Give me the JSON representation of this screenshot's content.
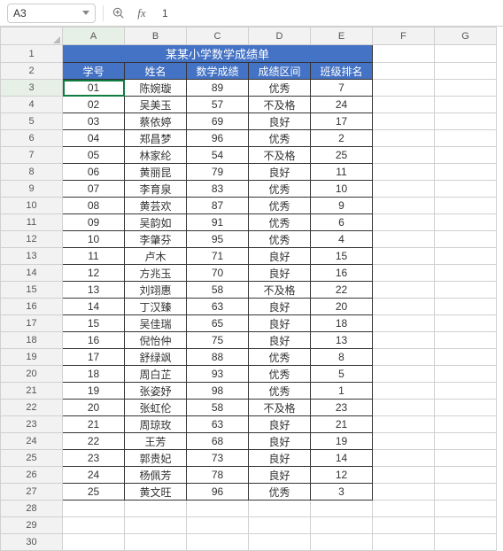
{
  "toolbar": {
    "namebox_value": "A3",
    "formula_value": "1"
  },
  "columns": [
    "A",
    "B",
    "C",
    "D",
    "E",
    "F",
    "G"
  ],
  "sheet_title": "某某小学数学成绩单",
  "headers": [
    "学号",
    "姓名",
    "数学成绩",
    "成绩区间",
    "班级排名"
  ],
  "rows": [
    [
      "01",
      "陈婉璇",
      "89",
      "优秀",
      "7"
    ],
    [
      "02",
      "吴美玉",
      "57",
      "不及格",
      "24"
    ],
    [
      "03",
      "蔡依婷",
      "69",
      "良好",
      "17"
    ],
    [
      "04",
      "郑昌梦",
      "96",
      "优秀",
      "2"
    ],
    [
      "05",
      "林家纶",
      "54",
      "不及格",
      "25"
    ],
    [
      "06",
      "黄丽昆",
      "79",
      "良好",
      "11"
    ],
    [
      "07",
      "李育泉",
      "83",
      "优秀",
      "10"
    ],
    [
      "08",
      "黄芸欢",
      "87",
      "优秀",
      "9"
    ],
    [
      "09",
      "吴韵如",
      "91",
      "优秀",
      "6"
    ],
    [
      "10",
      "李肇芬",
      "95",
      "优秀",
      "4"
    ],
    [
      "11",
      "卢木",
      "71",
      "良好",
      "15"
    ],
    [
      "12",
      "方兆玉",
      "70",
      "良好",
      "16"
    ],
    [
      "13",
      "刘翊惠",
      "58",
      "不及格",
      "22"
    ],
    [
      "14",
      "丁汉臻",
      "63",
      "良好",
      "20"
    ],
    [
      "15",
      "吴佳瑞",
      "65",
      "良好",
      "18"
    ],
    [
      "16",
      "倪怡仲",
      "75",
      "良好",
      "13"
    ],
    [
      "17",
      "舒绿飒",
      "88",
      "优秀",
      "8"
    ],
    [
      "18",
      "周白芷",
      "93",
      "优秀",
      "5"
    ],
    [
      "19",
      "张姿妤",
      "98",
      "优秀",
      "1"
    ],
    [
      "20",
      "张虹伦",
      "58",
      "不及格",
      "23"
    ],
    [
      "21",
      "周琼玫",
      "63",
      "良好",
      "21"
    ],
    [
      "22",
      "王芳",
      "68",
      "良好",
      "19"
    ],
    [
      "23",
      "郭贵妃",
      "73",
      "良好",
      "14"
    ],
    [
      "24",
      "杨佩芳",
      "78",
      "良好",
      "12"
    ],
    [
      "25",
      "黄文旺",
      "96",
      "优秀",
      "3"
    ]
  ],
  "selected": {
    "row": 3,
    "col": "A"
  }
}
